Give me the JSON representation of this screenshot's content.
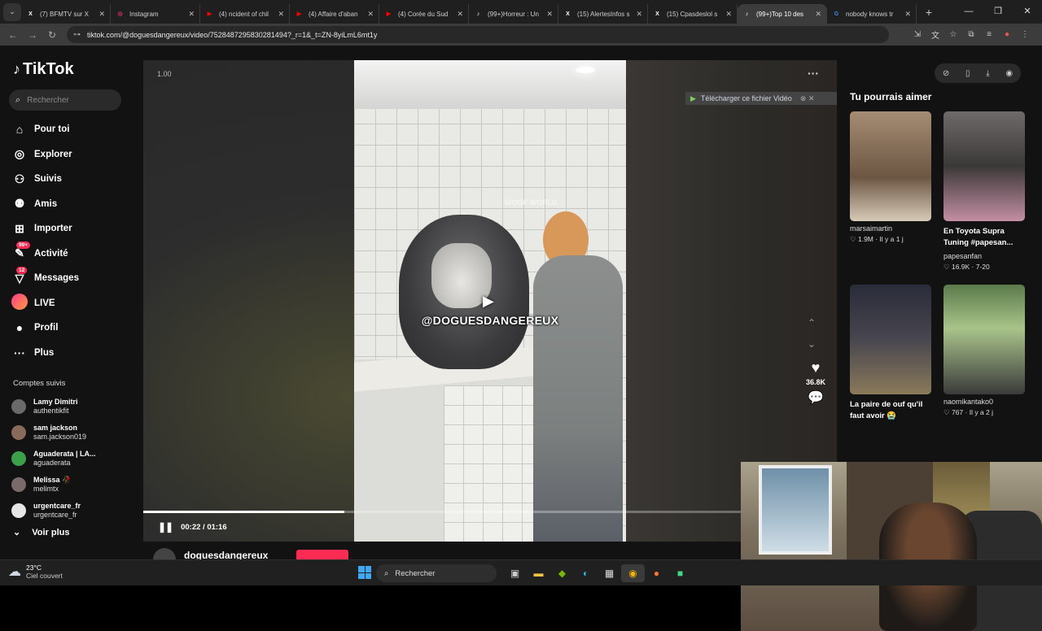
{
  "browser": {
    "tabs": [
      {
        "title": "(7) BFMTV sur X",
        "icon": "x-logo-icon",
        "color": "#ffffff"
      },
      {
        "title": "Instagram",
        "icon": "instagram-icon",
        "color": "#e1306c"
      },
      {
        "title": "(4) ncident of chil",
        "icon": "youtube-icon",
        "color": "#ff0000"
      },
      {
        "title": "(4) Affaire d'aban",
        "icon": "youtube-icon",
        "color": "#ff0000"
      },
      {
        "title": "(4) Corée du Sud",
        "icon": "youtube-icon",
        "color": "#ff0000"
      },
      {
        "title": "(99+)Horreur : Un",
        "icon": "tiktok-icon",
        "color": "#ffffff"
      },
      {
        "title": "(15) AlertesInfos s",
        "icon": "x-logo-icon",
        "color": "#ffffff"
      },
      {
        "title": "(15) Cpasdeslol s",
        "icon": "x-logo-icon",
        "color": "#ffffff"
      },
      {
        "title": "(99+)Top 10 des",
        "icon": "tiktok-icon",
        "color": "#ffffff",
        "active": true
      },
      {
        "title": "nobody knows tr",
        "icon": "google-icon",
        "color": "#4285f4"
      }
    ],
    "url": "tiktok.com/@doguesdangereux/video/7528487295830281494?_r=1&_t=ZN-8yiLmL6mt1y"
  },
  "tiktok": {
    "logo": "TikTok",
    "search_placeholder": "Rechercher",
    "menu": [
      {
        "label": "Pour toi",
        "icon": "home-icon",
        "glyph": "⌂"
      },
      {
        "label": "Explorer",
        "icon": "compass-icon",
        "glyph": "◎"
      },
      {
        "label": "Suivis",
        "icon": "following-icon",
        "glyph": "⚇"
      },
      {
        "label": "Amis",
        "icon": "friends-icon",
        "glyph": "⚉"
      },
      {
        "label": "Importer",
        "icon": "upload-icon",
        "glyph": "⊞"
      },
      {
        "label": "Activité",
        "icon": "activity-icon",
        "glyph": "✎",
        "badge": "99+"
      },
      {
        "label": "Messages",
        "icon": "messages-icon",
        "glyph": "▽",
        "badge": "12"
      },
      {
        "label": "LIVE",
        "icon": "live-icon",
        "glyph": ""
      },
      {
        "label": "Profil",
        "icon": "profile-icon",
        "glyph": "●"
      },
      {
        "label": "Plus",
        "icon": "more-icon",
        "glyph": "···"
      }
    ],
    "followed_title": "Comptes suivis",
    "followed": [
      {
        "name": "Lamy Dimitri",
        "user": "authentikfit",
        "color": "#6a6a6a"
      },
      {
        "name": "sam jackson",
        "user": "sam.jackson019",
        "color": "#8a6a5a"
      },
      {
        "name": "Aguaderata | LA...",
        "user": "aguaderata",
        "color": "#3aa04a"
      },
      {
        "name": "Melissa 🥀",
        "user": "melimtx",
        "color": "#7a6a6a"
      },
      {
        "name": "urgentcare_fr",
        "user": "urgentcare_fr",
        "color": "#e6e6e6"
      }
    ],
    "see_more": "Voir plus",
    "player": {
      "speed": "1.00",
      "overlay_text": "@DOGUESDANGEREUX",
      "watermark": "WOOF WORLD",
      "likes": "36.8K",
      "time": "00:22 / 01:16",
      "progress": 0.29
    },
    "download_banner": "Télécharger ce fichier Vidéo",
    "author": "doguesdangereux",
    "recommend_title": "Tu pourrais aimer",
    "cards": [
      {
        "caption": "",
        "author": "marsaimartin",
        "stats": "♡ 1.9M · Il y a 1 j",
        "bg": "linear-gradient(#a58c74,#6c5643 60%,#d7cbb8)"
      },
      {
        "caption": "En Toyota Supra Tuning #papesan...",
        "author": "papesanfan",
        "stats": "♡ 16.9K · 7-20",
        "bg": "linear-gradient(#6f6a6a,#3b3838 50%,#c48fa3)"
      },
      {
        "caption": "La paire de ouf qu'il faut avoir 😭",
        "author": "",
        "stats": "",
        "bg": "linear-gradient(#2a2c3a,#48464f 50%,#8a7a5a)"
      },
      {
        "caption": "",
        "author": "naomikantako0",
        "stats": "♡ 767 · Il y a 2 j",
        "bg": "linear-gradient(#5a7a4a,#a9c48a 40%,#3a3a3a)"
      }
    ]
  },
  "taskbar": {
    "temp": "23°C",
    "weather": "Ciel couvert",
    "search": "Rechercher"
  }
}
